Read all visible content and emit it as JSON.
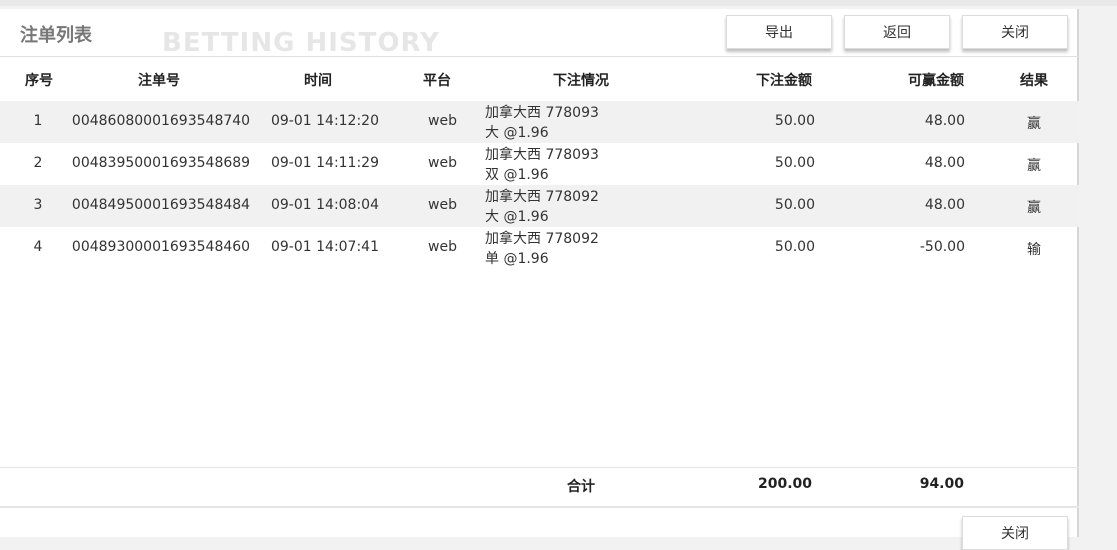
{
  "header": {
    "title": "注单列表",
    "watermark": "BETTING HISTORY",
    "buttons": {
      "export": "导出",
      "back": "返回",
      "close": "关闭"
    }
  },
  "table": {
    "columns": [
      "序号",
      "注单号",
      "时间",
      "平台",
      "下注情况",
      "下注金额",
      "可赢金额",
      "结果"
    ],
    "rows": [
      {
        "index": "1",
        "order_no": "00486080001693548740",
        "time": "09-01 14:12:20",
        "platform": "web",
        "detail_line1": "加拿大西 778093",
        "detail_line2": "大 @1.96",
        "bet_amount": "50.00",
        "win_amount": "48.00",
        "result": "赢"
      },
      {
        "index": "2",
        "order_no": "00483950001693548689",
        "time": "09-01 14:11:29",
        "platform": "web",
        "detail_line1": "加拿大西 778093",
        "detail_line2": "双 @1.96",
        "bet_amount": "50.00",
        "win_amount": "48.00",
        "result": "赢"
      },
      {
        "index": "3",
        "order_no": "00484950001693548484",
        "time": "09-01 14:08:04",
        "platform": "web",
        "detail_line1": "加拿大西 778092",
        "detail_line2": "大 @1.96",
        "bet_amount": "50.00",
        "win_amount": "48.00",
        "result": "赢"
      },
      {
        "index": "4",
        "order_no": "00489300001693548460",
        "time": "09-01 14:07:41",
        "platform": "web",
        "detail_line1": "加拿大西 778092",
        "detail_line2": "单 @1.96",
        "bet_amount": "50.00",
        "win_amount": "-50.00",
        "result": "输"
      }
    ],
    "totals": {
      "label": "合计",
      "bet_total": "200.00",
      "win_total": "94.00"
    }
  },
  "footer": {
    "close": "关闭"
  }
}
